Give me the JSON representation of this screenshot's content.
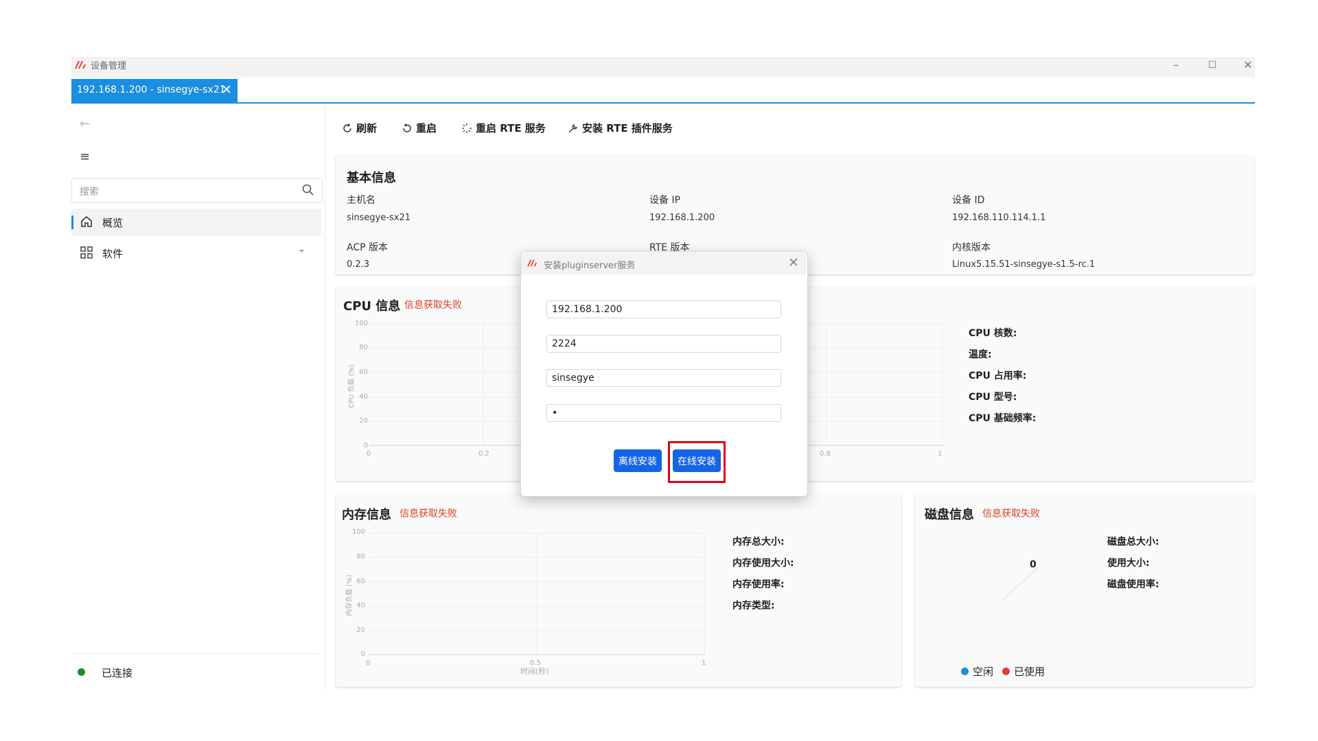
{
  "window": {
    "title": "设备管理",
    "minimize": "–",
    "maximize": "☐",
    "close": "✕"
  },
  "tab": {
    "label": "192.168.1.200 - sinsegye-sx21",
    "close": "✕"
  },
  "sidebar": {
    "back": "←",
    "menu": "≡",
    "search_placeholder": "搜索",
    "items": [
      {
        "label": "概览",
        "icon": "home-icon"
      },
      {
        "label": "软件",
        "icon": "grid-icon"
      }
    ],
    "expand": "⌄",
    "status": "已连接",
    "status_color": "#1e8c2e"
  },
  "toolbar": {
    "refresh": "刷新",
    "restart": "重启",
    "restart_rte": "重启 RTE 服务",
    "install_rte": "安装 RTE 插件服务"
  },
  "basic": {
    "title": "基本信息",
    "fields": [
      {
        "label": "主机名",
        "value": "sinsegye-sx21"
      },
      {
        "label": "设备 IP",
        "value": "192.168.1.200"
      },
      {
        "label": "设备 ID",
        "value": "192.168.110.114.1.1"
      },
      {
        "label": "ACP 版本",
        "value": "0.2.3"
      },
      {
        "label": "RTE 版本",
        "value": ""
      },
      {
        "label": "内核版本",
        "value": "Linux5.15.51-sinsegye-s1.5-rc.1"
      }
    ]
  },
  "cpu": {
    "title": "CPU 信息",
    "error": "信息获取失败",
    "yaxis_title": "CPU 负载 (%)",
    "stats": [
      "CPU 核数:",
      "温度:",
      "CPU 占用率:",
      "CPU 型号:",
      "CPU 基础频率:"
    ]
  },
  "memory": {
    "title": "内存信息",
    "error": "信息获取失败",
    "yaxis_title": "内存负载 (%)",
    "xaxis_title": "时间(秒)",
    "stats": [
      "内存总大小:",
      "内存使用大小:",
      "内存使用率:",
      "内存类型:"
    ]
  },
  "disk": {
    "title": "磁盘信息",
    "error": "信息获取失败",
    "pie_value": "0",
    "stats": [
      "磁盘总大小:",
      "使用大小:",
      "磁盘使用率:"
    ],
    "legend": [
      {
        "label": "空闲",
        "color": "#1a8ee0"
      },
      {
        "label": "已使用",
        "color": "#e53935"
      }
    ]
  },
  "chart_data": [
    {
      "type": "line",
      "ylabel": "CPU 负载 (%)",
      "ylim": [
        0,
        100
      ],
      "xlim": [
        0,
        1
      ],
      "yticks": [
        "100",
        "80",
        "60",
        "40",
        "20",
        "0"
      ],
      "xticks": [
        "0",
        "0.2",
        "0.8",
        "1"
      ],
      "series": []
    },
    {
      "type": "line",
      "ylabel": "内存负载 (%)",
      "xlabel": "时间(秒)",
      "ylim": [
        0,
        100
      ],
      "xlim": [
        0,
        1
      ],
      "yticks": [
        "100",
        "80",
        "60",
        "40",
        "20",
        "0"
      ],
      "xticks": [
        "0",
        "0.5",
        "1"
      ],
      "series": []
    }
  ],
  "dialog": {
    "title": "安装pluginserver服务",
    "close": "✕",
    "ip": "192.168.1.200",
    "port": "2224",
    "user": "sinsegye",
    "password": "•",
    "offline_button": "离线安装",
    "online_button": "在线安装",
    "highlight_color": "#e0001b"
  }
}
